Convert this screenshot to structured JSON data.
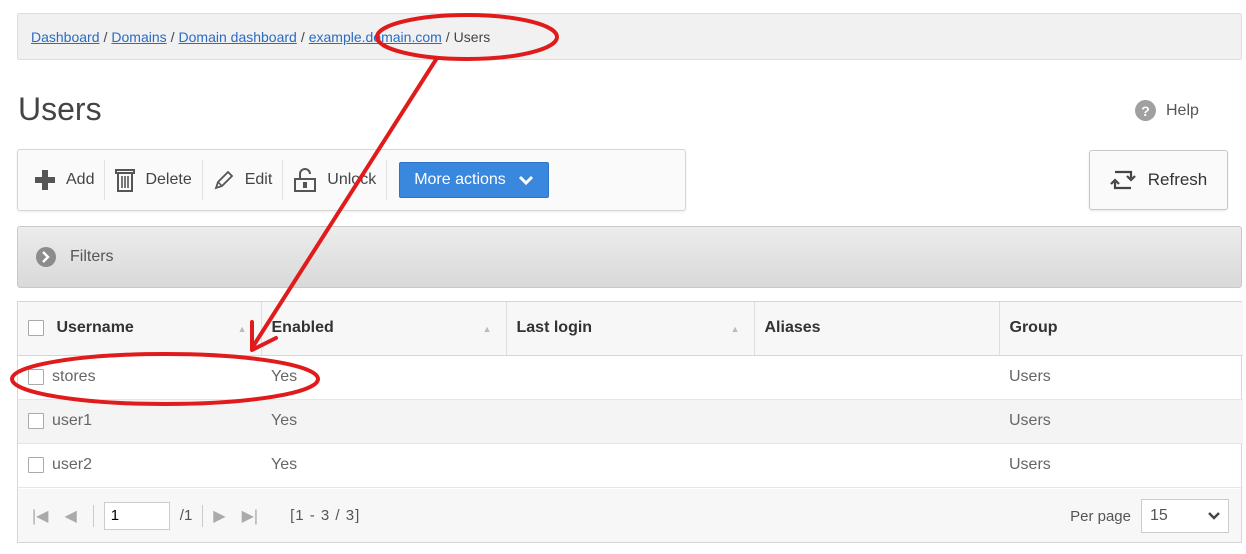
{
  "breadcrumb": {
    "dashboard": "Dashboard",
    "domains": "Domains",
    "domain_dashboard": "Domain dashboard",
    "domain": "example.domain.com",
    "current": "Users",
    "separator": "/"
  },
  "page": {
    "title": "Users",
    "help": "Help"
  },
  "toolbar": {
    "add": "Add",
    "delete": "Delete",
    "edit": "Edit",
    "unlock": "Unlock",
    "more_actions": "More actions",
    "refresh": "Refresh"
  },
  "filters": {
    "label": "Filters"
  },
  "table": {
    "columns": [
      "Username",
      "Enabled",
      "Last login",
      "Aliases",
      "Group"
    ],
    "rows": [
      {
        "username": "stores",
        "enabled": "Yes",
        "last_login": "",
        "aliases": "",
        "group": "Users"
      },
      {
        "username": "user1",
        "enabled": "Yes",
        "last_login": "",
        "aliases": "",
        "group": "Users"
      },
      {
        "username": "user2",
        "enabled": "Yes",
        "last_login": "",
        "aliases": "",
        "group": "Users"
      }
    ]
  },
  "pager": {
    "page": "1",
    "total_pages": "/1",
    "range": "[1 - 3 / 3]",
    "per_page_label": "Per page",
    "per_page": "15"
  },
  "colors": {
    "accent": "#3a87de",
    "annotation": "#e01b1b",
    "link": "#2b6bc2"
  }
}
